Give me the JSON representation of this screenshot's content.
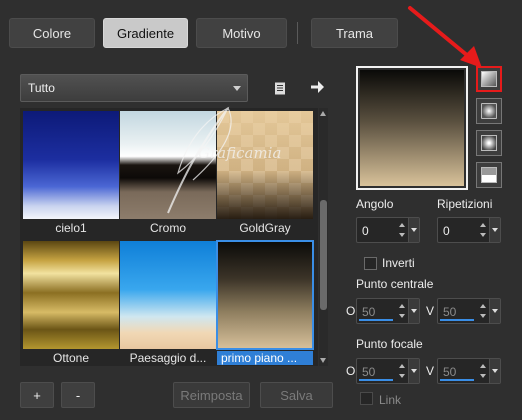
{
  "tabs": [
    {
      "label": "Colore"
    },
    {
      "label": "Gradiente",
      "active": true
    },
    {
      "label": "Motivo"
    },
    {
      "label": "Trama"
    }
  ],
  "category": {
    "selected": "Tutto"
  },
  "gradients": [
    {
      "name": "cielo1"
    },
    {
      "name": "Cromo"
    },
    {
      "name": "GoldGray"
    },
    {
      "name": "Ottone"
    },
    {
      "name": "Paesaggio d..."
    },
    {
      "name": "primo piano ...",
      "selected": true
    }
  ],
  "watermark": {
    "text": "Graficamia"
  },
  "buttons": {
    "add": "+",
    "remove": "-",
    "reset": "Reimposta",
    "save": "Salva"
  },
  "gradient_types": [
    {
      "name": "linear",
      "active": true
    },
    {
      "name": "rectangular"
    },
    {
      "name": "radial"
    },
    {
      "name": "sunburst"
    }
  ],
  "angle": {
    "label": "Angolo",
    "value": "0"
  },
  "repeats": {
    "label": "Ripetizioni",
    "value": "0"
  },
  "invert": {
    "label": "Inverti",
    "checked": false
  },
  "center_point": {
    "label": "Punto centrale",
    "h_label": "O",
    "h_value": "50",
    "v_label": "V",
    "v_value": "50"
  },
  "focal_point": {
    "label": "Punto focale",
    "h_label": "O",
    "h_value": "50",
    "v_label": "V",
    "v_value": "50"
  },
  "link": {
    "label": "Link",
    "checked": false
  },
  "colors": {
    "accent": "#2f7fd6",
    "annotation_arrow": "#e61b1b"
  }
}
